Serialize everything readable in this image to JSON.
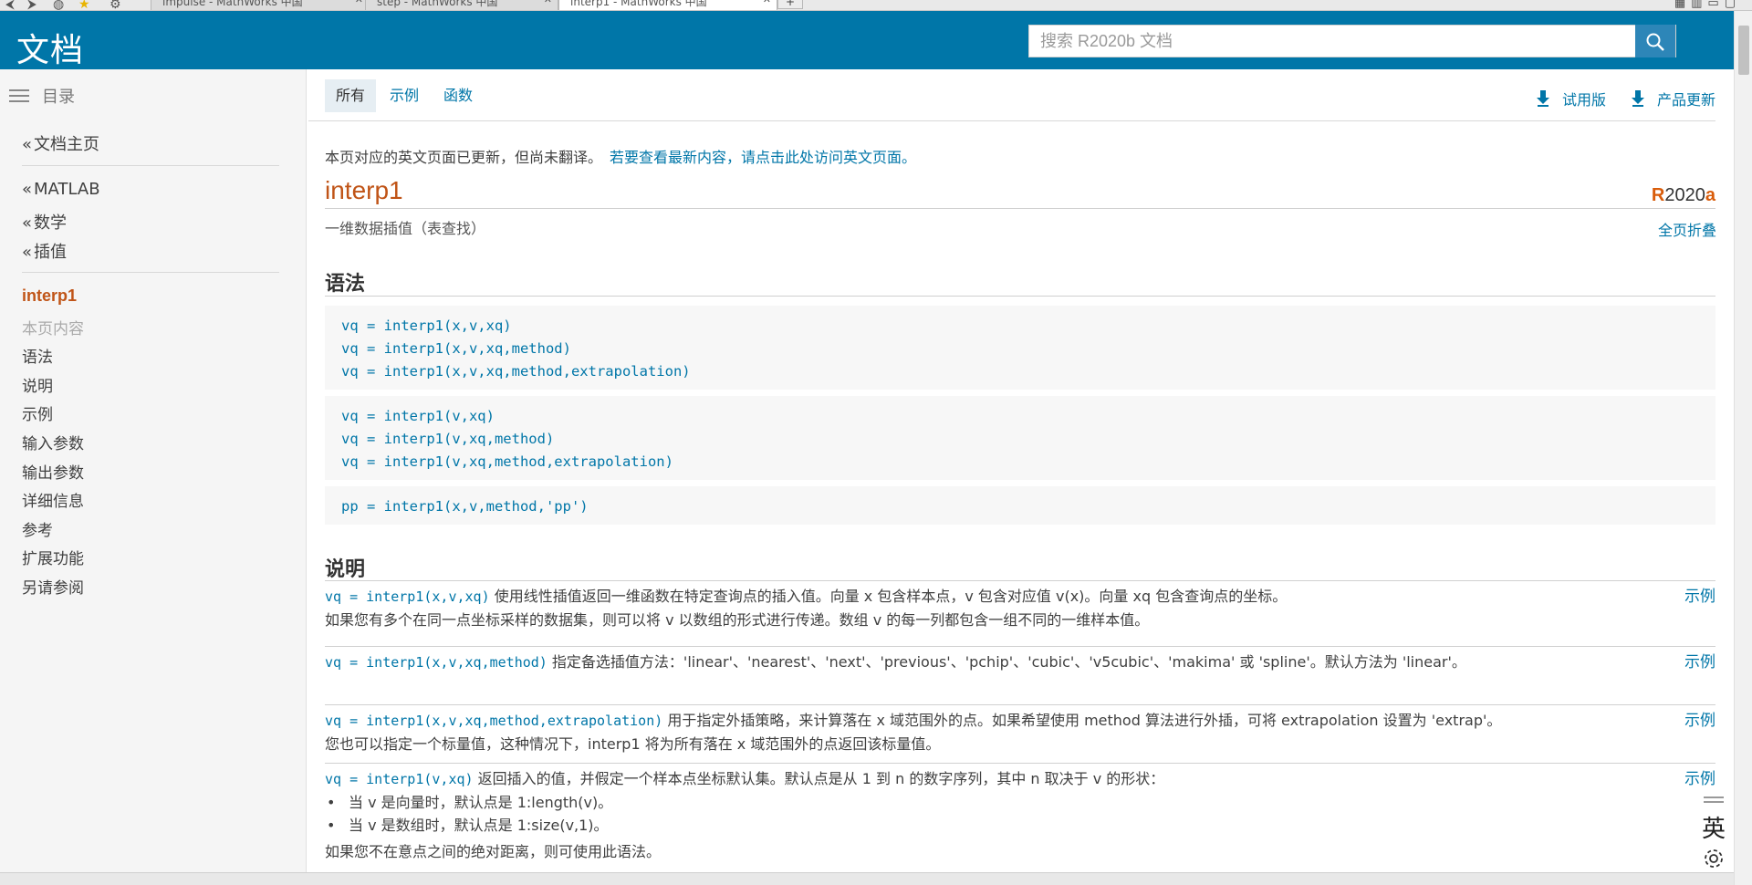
{
  "browser": {
    "tabs": [
      "impulse - MathWorks 中国",
      "step - MathWorks 中国",
      "interp1 - MathWorks 中国"
    ],
    "new_tab": "+"
  },
  "header": {
    "title": "文档",
    "search_placeholder": "搜索 R2020b 文档"
  },
  "sidebar": {
    "toc_label": "目录",
    "breadcrumbs": [
      "文档主页",
      "MATLAB",
      "数学",
      "插值"
    ],
    "current": "interp1",
    "on_page_label": "本页内容",
    "items": [
      "语法",
      "说明",
      "示例",
      "输入参数",
      "输出参数",
      "详细信息",
      "参考",
      "扩展功能",
      "另请参阅"
    ]
  },
  "filters": {
    "tabs": [
      "所有",
      "示例",
      "函数"
    ],
    "trial": "试用版",
    "updates": "产品更新"
  },
  "page": {
    "notice_text": "本页对应的英文页面已更新，但尚未翻译。",
    "notice_link": "若要查看最新内容，请点击此处访问英文页面。",
    "title": "interp1",
    "release_r": "R",
    "release_num": "2020",
    "release_a": "a",
    "subtitle": "一维数据插值（表查找）",
    "collapse_all": "全页折叠",
    "syntax_heading": "语法",
    "syntax_groups": [
      [
        "vq = interp1(x,v,xq)",
        "vq = interp1(x,v,xq,method)",
        "vq = interp1(x,v,xq,method,extrapolation)"
      ],
      [
        "vq = interp1(v,xq)",
        "vq = interp1(v,xq,method)",
        "vq = interp1(v,xq,method,extrapolation)"
      ],
      [
        "pp = interp1(x,v,method,'pp')"
      ]
    ],
    "desc_heading": "说明",
    "example_label": "示例",
    "desc": {
      "d1_code": "vq = interp1(x,v,xq)",
      "d1_text": " 使用线性插值返回一维函数在特定查询点的插入值。向量 x 包含样本点，v 包含对应值 v(x)。向量 xq 包含查询点的坐标。",
      "d1_text2": "如果您有多个在同一点坐标采样的数据集，则可以将 v 以数组的形式进行传递。数组 v 的每一列都包含一组不同的一维样本值。",
      "d2_code": "vq = interp1(x,v,xq,method)",
      "d2_text": " 指定备选插值方法：'linear'、'nearest'、'next'、'previous'、'pchip'、'cubic'、'v5cubic'、'makima' 或 'spline'。默认方法为 'linear'。",
      "d3_code": "vq = interp1(x,v,xq,method,extrapolation)",
      "d3_text": " 用于指定外插策略，来计算落在 x 域范围外的点。如果希望使用 method 算法进行外插，可将 extrapolation 设置为 'extrap'。",
      "d3_text2": "您也可以指定一个标量值，这种情况下，interp1 将为所有落在 x 域范围外的点返回该标量值。",
      "d4_code": "vq = interp1(v,xq)",
      "d4_text": " 返回插入的值，并假定一个样本点坐标默认集。默认点是从 1 到 n 的数字序列，其中 n 取决于 v 的形状：",
      "d4_b1": "当 v 是向量时，默认点是 1:length(v)。",
      "d4_b2": "当 v 是数组时，默认点是 1:size(v,1)。",
      "d4_tail": "如果您不在意点之间的绝对距离，则可使用此语法。"
    }
  },
  "ime": {
    "label": "英"
  }
}
